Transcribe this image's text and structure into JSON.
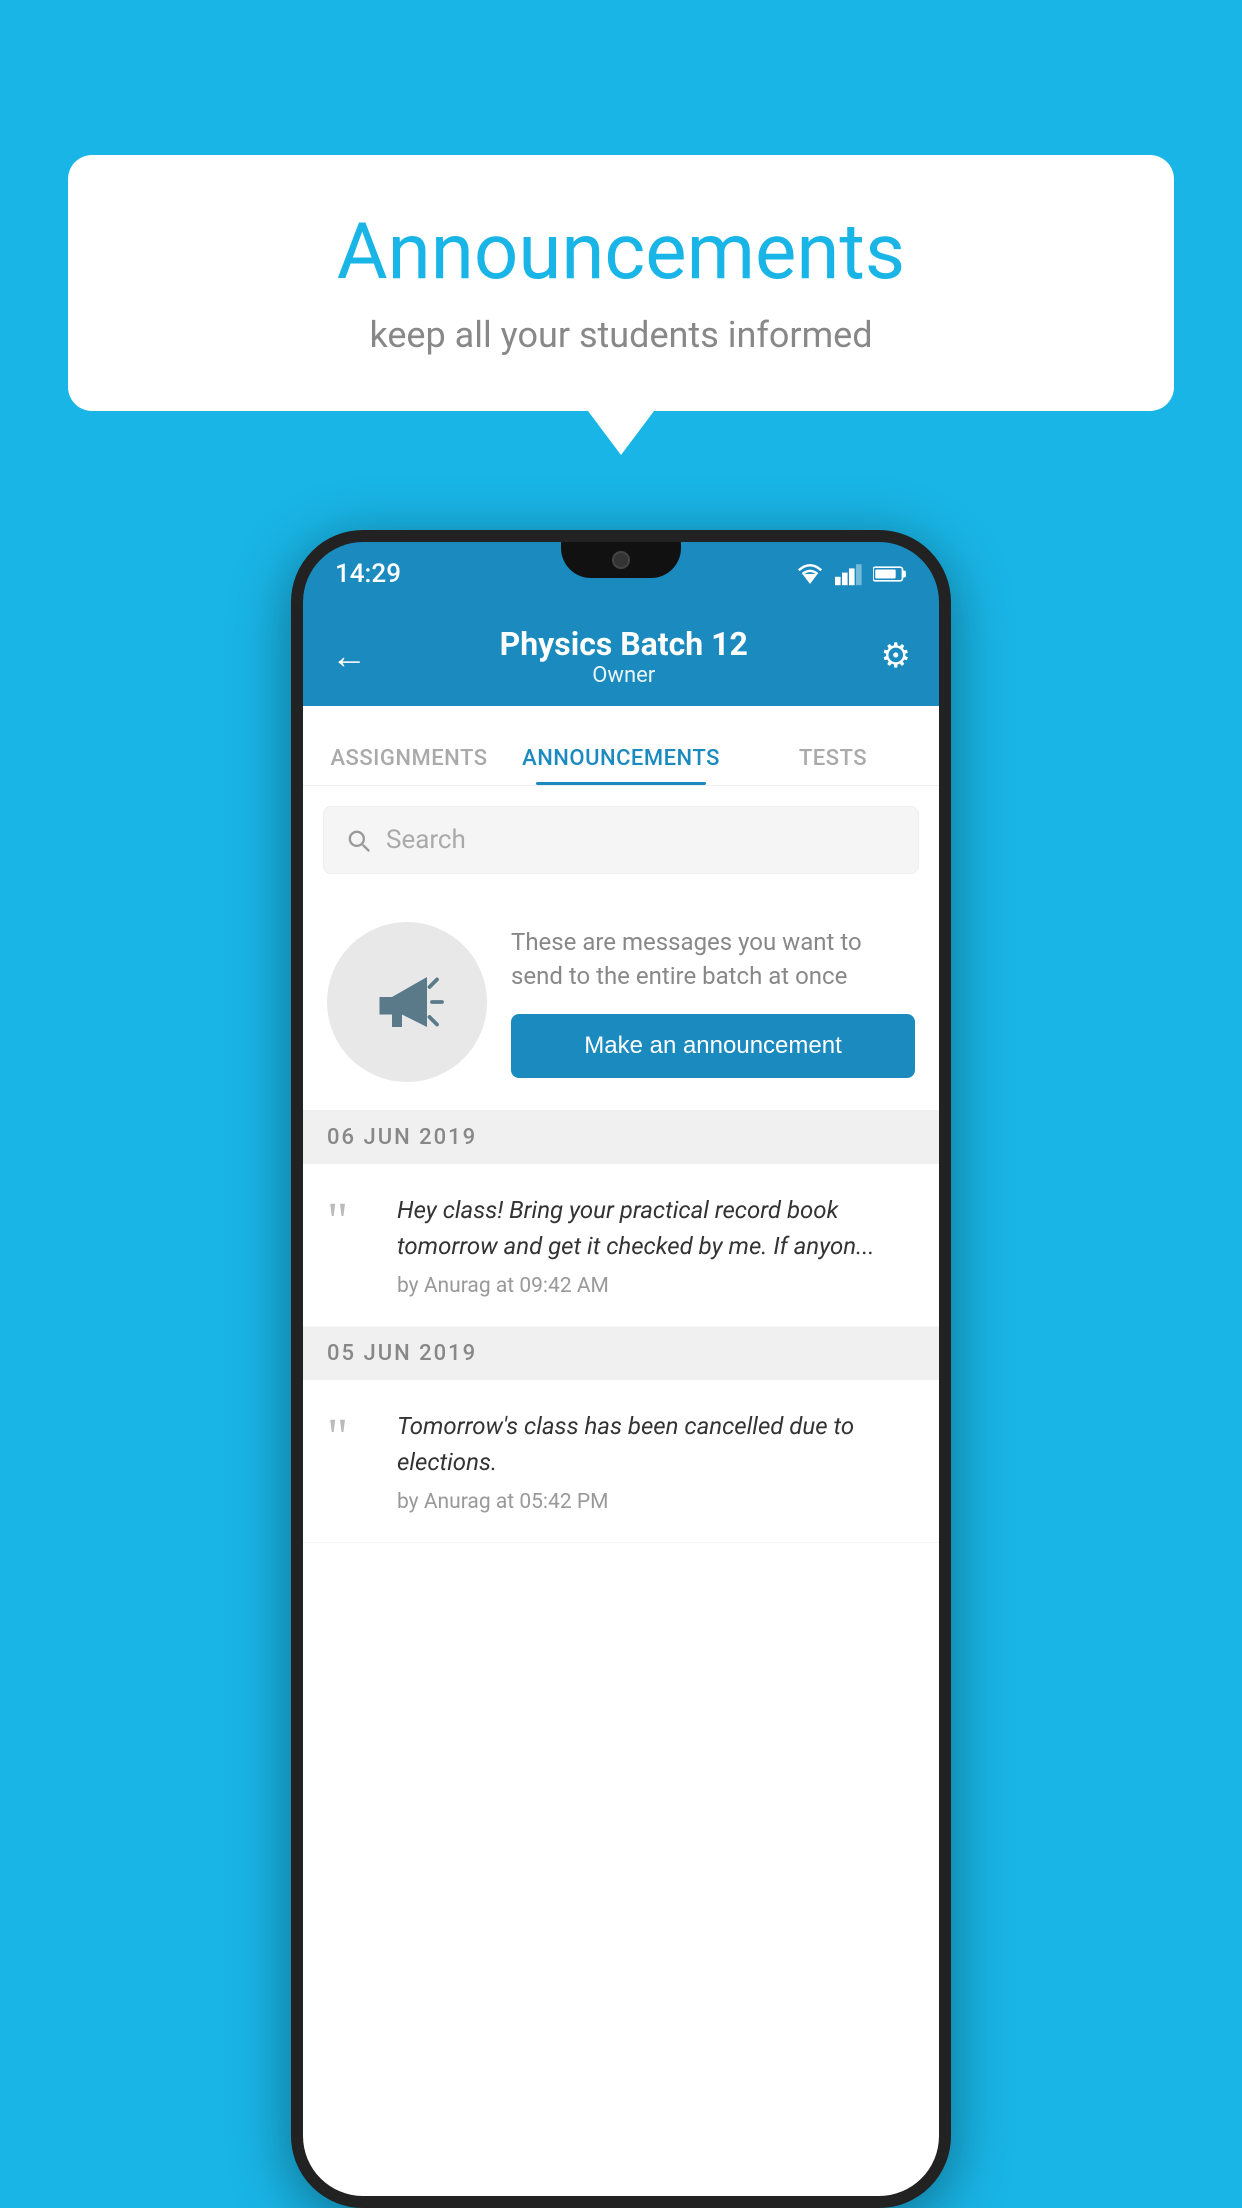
{
  "speech_bubble": {
    "title": "Announcements",
    "subtitle": "keep all your students informed"
  },
  "status_bar": {
    "time": "14:29"
  },
  "app_bar": {
    "back_icon": "←",
    "title": "Physics Batch 12",
    "subtitle": "Owner",
    "settings_icon": "⚙"
  },
  "tabs": [
    {
      "label": "ASSIGNMENTS",
      "active": false
    },
    {
      "label": "ANNOUNCEMENTS",
      "active": true
    },
    {
      "label": "TESTS",
      "active": false
    }
  ],
  "search": {
    "placeholder": "Search"
  },
  "announcement_prompt": {
    "description_text": "These are messages you want to send to the entire batch at once",
    "button_label": "Make an announcement"
  },
  "date_groups": [
    {
      "date": "06  JUN  2019",
      "items": [
        {
          "text": "Hey class! Bring your practical record book tomorrow and get it checked by me. If anyon...",
          "meta": "by Anurag at 09:42 AM"
        }
      ]
    },
    {
      "date": "05  JUN  2019",
      "items": [
        {
          "text": "Tomorrow's class has been cancelled due to elections.",
          "meta": "by Anurag at 05:42 PM"
        }
      ]
    }
  ]
}
